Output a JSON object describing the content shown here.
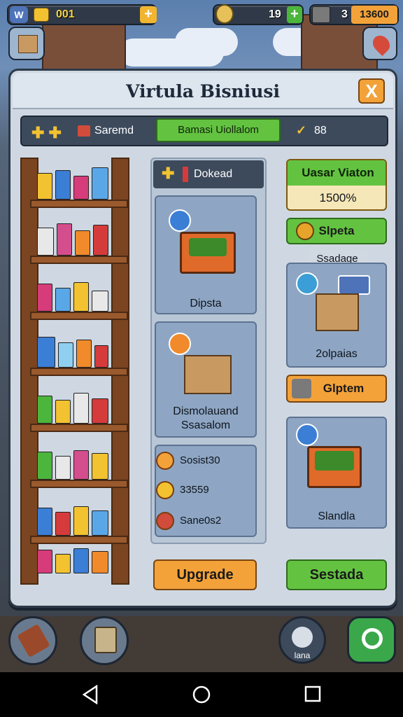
{
  "hud": {
    "level": "W",
    "coins": "001",
    "gems": "19",
    "crates": "3",
    "cash": "13600"
  },
  "panel": {
    "title": "Virtula Bisniusi",
    "close": "X"
  },
  "toolbar": {
    "tab_label": "Saremd",
    "progress_label": "Bamasi Uiollalom",
    "stat_value": "88"
  },
  "sections": {
    "left_header": "Dokead",
    "card_cart_label": "Dipsta",
    "card_box_label_1": "Dismolauand",
    "card_box_label_2": "Ssasalom",
    "checks": [
      "Sosist30",
      "33559",
      "Sane0s2"
    ],
    "upgrade": "Upgrade"
  },
  "right": {
    "stat_title": "Uasar Viaton",
    "stat_value": "1500%",
    "green_btn": "Slpeta",
    "storage_tag": "Ssadage",
    "storage_label": "2olpaias",
    "orange_btn": "Glptem",
    "cart_label": "Slandla",
    "bottom_btn": "Sestada"
  },
  "bottom": {
    "badge": "lana"
  },
  "colors": {
    "accent_orange": "#f3a23a",
    "accent_green": "#63c341",
    "panel_bg": "#cfd8e2",
    "card_blue": "#8ea6c4"
  }
}
